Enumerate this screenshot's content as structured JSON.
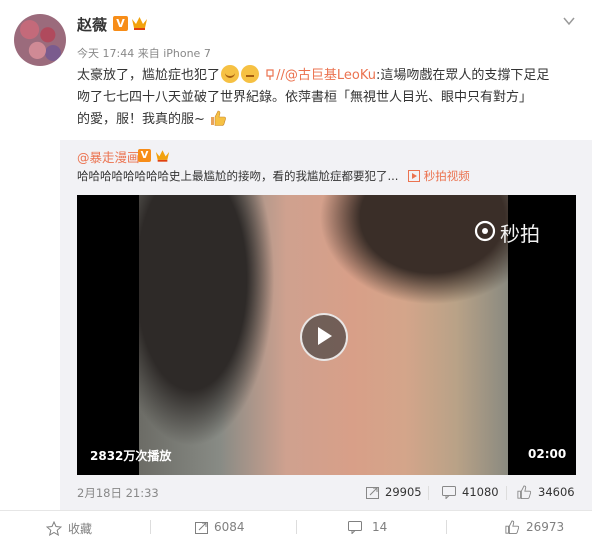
{
  "post": {
    "username": "赵薇",
    "vip_badge": "V",
    "meta": "今天 17:44 来自 iPhone 7",
    "text_1": "太豪放了，尴尬症也犯了",
    "mention": "//@古巨基LeoKu",
    "text_2": ":這場吻戲在眾人的支撐下足足",
    "text_3": "吻了七七四十八天並破了世界紀錄。依萍書桓「無視世人目光、眼中只有對方」",
    "text_4": "的愛，服！我真的服~"
  },
  "repost": {
    "username": "@暴走漫画",
    "vip_badge": "V",
    "text": "哈哈哈哈哈哈哈哈史上最尴尬的接吻，看的我尴尬症都要犯了...",
    "video_link": "秒拍视频",
    "video": {
      "watermark": "秒拍",
      "views": "2832万次播放",
      "duration": "02:00"
    },
    "date": "2月18日 21:33",
    "forwards": "29905",
    "comments": "41080",
    "likes": "34606"
  },
  "actions": {
    "favorite": "收藏",
    "forward": "6084",
    "comment": "14",
    "like": "26973"
  },
  "colors": {
    "accent": "#eb7350",
    "badge": "#f78d18",
    "muted": "#888888"
  },
  "icons": [
    "chevron-down-icon",
    "crown-icon",
    "vip-icon",
    "play-icon",
    "forward-icon",
    "comment-icon",
    "like-icon",
    "favorite-icon",
    "link-icon",
    "miaopai-logo-icon",
    "thumbs-up-icon"
  ]
}
